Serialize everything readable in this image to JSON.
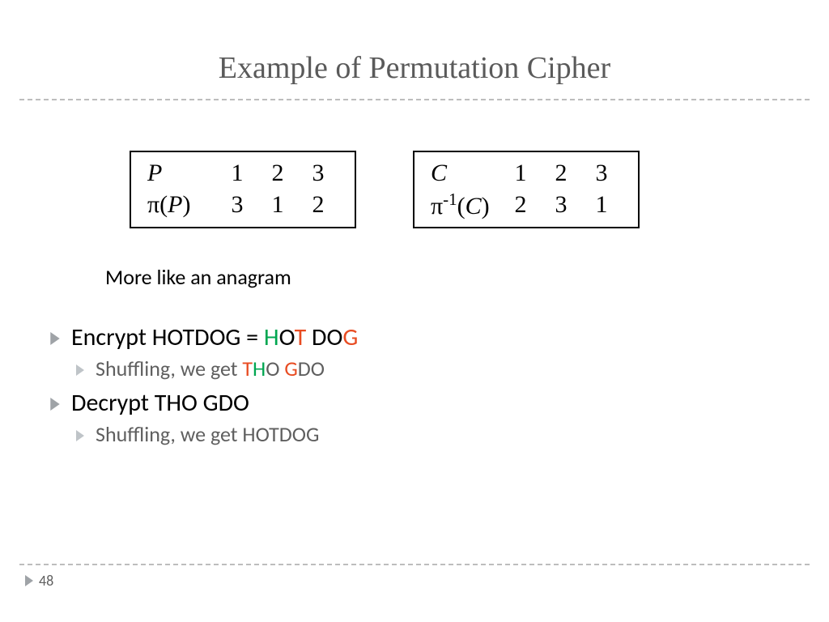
{
  "title": "Example of Permutation Cipher",
  "tableP": {
    "r1": {
      "label": "P",
      "c1": "1",
      "c2": "2",
      "c3": "3"
    },
    "r2": {
      "pi": "π(",
      "var": "P",
      "close": ")",
      "c1": "3",
      "c2": "1",
      "c3": "2"
    }
  },
  "tableC": {
    "r1": {
      "label": "C",
      "c1": "1",
      "c2": "2",
      "c3": "3"
    },
    "r2": {
      "pi": "π",
      "sup": "-1",
      "open": "(",
      "var": "C",
      "close": ")",
      "c1": "2",
      "c2": "3",
      "c3": "1"
    }
  },
  "note": "More like an anagram",
  "bullets": {
    "encrypt": {
      "prefix": "Encrypt HOTDOG = ",
      "h": "H",
      "o1": "O",
      "t": "T",
      "sp": " D",
      "o2": "O",
      "g": "G"
    },
    "encryptSub": {
      "prefix": "Shuffling, we get ",
      "t": "T",
      "h": "H",
      "o": "O ",
      "g": "G",
      "do": "DO"
    },
    "decrypt": "Decrypt THO GDO",
    "decryptSub": "Shuffling, we get HOTDOG"
  },
  "pageNumber": "48"
}
